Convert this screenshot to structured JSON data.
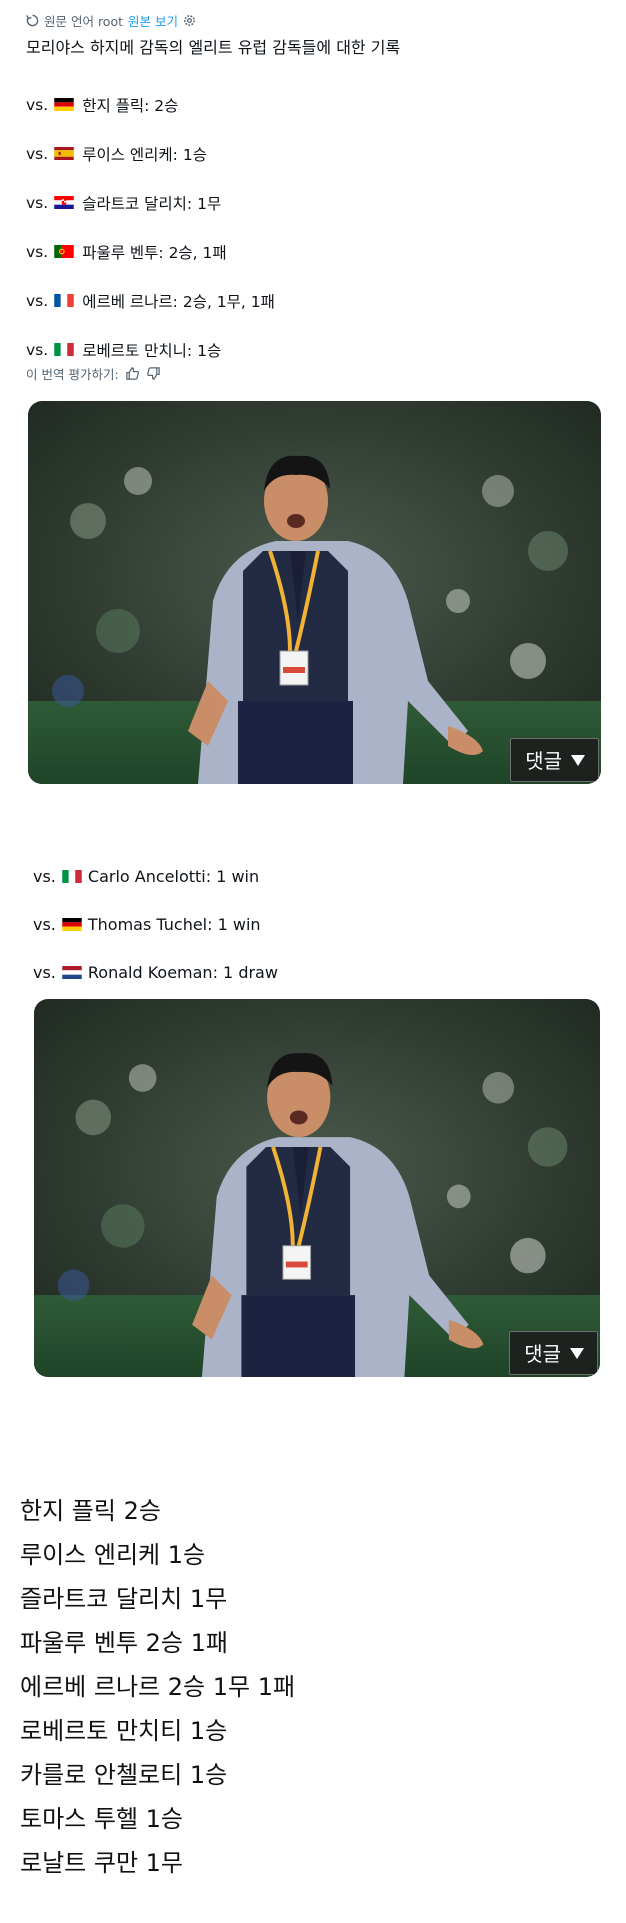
{
  "translation_bar": {
    "label": "원문 언어 root",
    "view_original": "원본 보기"
  },
  "title": "모리야스 하지메 감독의 엘리트 유럽 감독들에 대한 기록",
  "records": [
    {
      "vs": "vs.",
      "flag": "germany",
      "text": " 한지 플릭: 2승"
    },
    {
      "vs": "vs.",
      "flag": "spain",
      "text": "루이스 엔리케: 1승"
    },
    {
      "vs": "vs.",
      "flag": "croatia",
      "text": "슬라트코 달리치: 1무"
    },
    {
      "vs": "vs.",
      "flag": "portugal",
      "text": "파울루 벤투: 2승, 1패"
    },
    {
      "vs": "vs.",
      "flag": "france",
      "text": "에르베 르나르: 2승, 1무, 1패"
    },
    {
      "vs": "vs.",
      "flag": "italy",
      "text": "로베르토 만치니: 1승"
    }
  ],
  "rate_translation": "이 번역 평가하기:",
  "photo_button": "댓글",
  "english_records": [
    {
      "vs": "vs.",
      "flag": "italy",
      "text": "Carlo Ancelotti: 1 win"
    },
    {
      "vs": "vs.",
      "flag": "germany",
      "text": "Thomas Tuchel: 1 win"
    },
    {
      "vs": "vs.",
      "flag": "netherlands",
      "text": "Ronald Koeman: 1 draw"
    }
  ],
  "summary": [
    "한지 플릭 2승",
    "루이스 엔리케 1승",
    "즐라트코 달리치 1무",
    "파울루 벤투 2승 1패",
    "에르베 르나르 2승 1무 1패",
    "로베르토 만치티 1승",
    "카를로 안첼로티 1승",
    "토마스 투헬 1승",
    "로날트 쿠만 1무"
  ],
  "icons": {
    "translate": "translate-icon",
    "settings": "gear-icon",
    "thumbs_up": "thumbs-up-icon",
    "thumbs_down": "thumbs-down-icon",
    "dropdown": "triangle-down-icon"
  },
  "colors": {
    "link": "#1d9bf0",
    "muted": "#536471",
    "text": "#0f1419",
    "button_bg": "#1c1c1c"
  }
}
